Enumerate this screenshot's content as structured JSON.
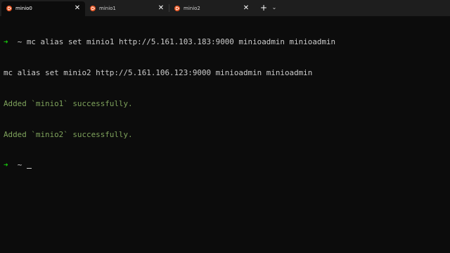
{
  "tabs": [
    {
      "title": "minio0",
      "active": true,
      "icon": "ubuntu-icon",
      "close": "✕"
    },
    {
      "title": "minio1",
      "active": false,
      "icon": "ubuntu-icon",
      "close": "✕"
    },
    {
      "title": "minio2",
      "active": false,
      "icon": "ubuntu-icon",
      "close": "✕"
    }
  ],
  "tabbar": {
    "new_tab": "+",
    "dropdown": "⌄"
  },
  "terminal": {
    "prompt_arrow": "➜",
    "prompt_dir": "~",
    "lines": [
      {
        "kind": "command",
        "text": "mc alias set minio1 http://5.161.103.183:9000 minioadmin minioadmin"
      },
      {
        "kind": "output",
        "text": "mc alias set minio2 http://5.161.106.123:9000 minioadmin minioadmin"
      },
      {
        "kind": "success",
        "text": "Added `minio1` successfully."
      },
      {
        "kind": "success",
        "text": "Added `minio2` successfully."
      }
    ]
  },
  "colors": {
    "background": "#0c0c0c",
    "tabbar": "#1e1e1e",
    "prompt_arrow": "#16c60c",
    "success_text": "#7fa35c",
    "ubuntu_orange": "#e95420"
  }
}
